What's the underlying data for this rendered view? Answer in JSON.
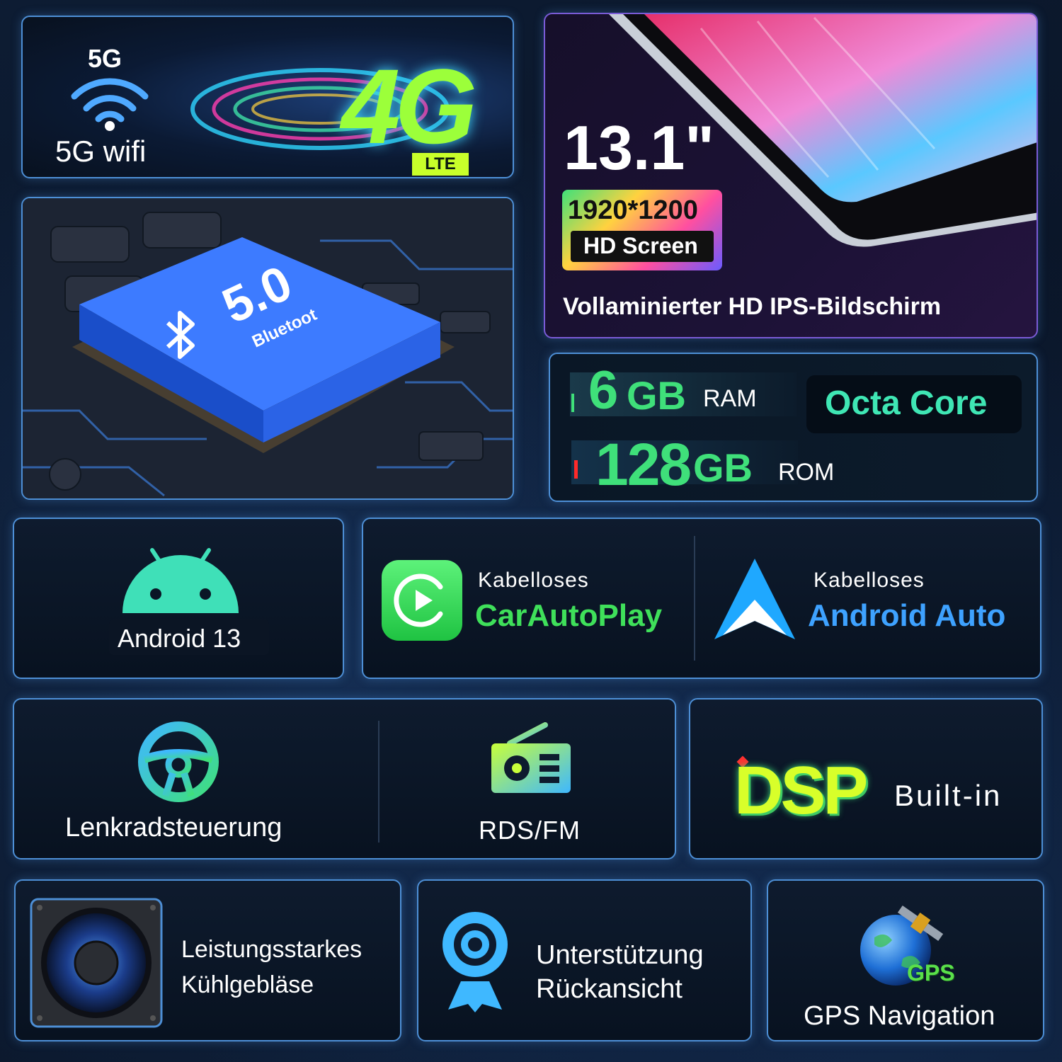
{
  "wifi": {
    "badge": "5G",
    "label": "5G wifi",
    "logo_text": "4G",
    "logo_sub": "LTE"
  },
  "bluetooth": {
    "version": "5.0",
    "name": "Bluetoot"
  },
  "screen": {
    "size": "13.1\"",
    "resolution": "1920*1200",
    "resolution_sub": "HD Screen",
    "caption": "Vollaminierter HD IPS-Bildschirm"
  },
  "memory": {
    "ram_value": "6",
    "ram_unit": "GB",
    "ram_label": "RAM",
    "rom_value": "128",
    "rom_unit": "GB",
    "rom_label": "ROM",
    "cpu": "Octa Core"
  },
  "android": {
    "label": "Android 13"
  },
  "carplay": {
    "pre": "Kabelloses",
    "name": "CarAutoPlay"
  },
  "android_auto": {
    "pre": "Kabelloses",
    "name": "Android Auto"
  },
  "steering": {
    "label": "Lenkradsteuerung"
  },
  "radio": {
    "label": "RDS/FM"
  },
  "dsp": {
    "logo": "DSP",
    "label": "Built-in"
  },
  "fan": {
    "line1": "Leistungsstarkes",
    "line2": "Kühlgebläse"
  },
  "camera": {
    "line1": "Unterstützung",
    "line2": "Rückansicht"
  },
  "gps": {
    "badge": "GPS",
    "label": "GPS Navigation"
  },
  "colors": {
    "accent_green": "#3fe07a",
    "accent_blue": "#3ea2ff",
    "border": "#4d8fd6"
  }
}
